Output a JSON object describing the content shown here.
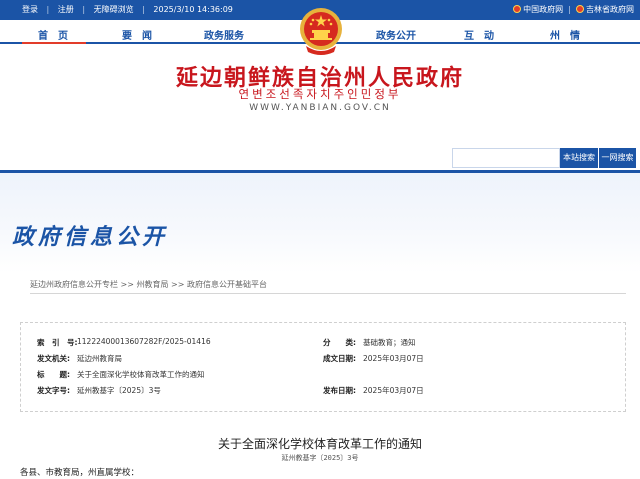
{
  "topbar": {
    "login": "登录",
    "register": "注册",
    "accessibility": "无障碍浏览",
    "datetime": "2025/3/10 14:36:09",
    "link_gov": "中国政府网",
    "link_jilin": "吉林省政府网"
  },
  "nav": {
    "items": [
      "首　页",
      "要　闻",
      "政务服务",
      "政务公开",
      "互　动",
      "州　情"
    ],
    "active_index": 0
  },
  "header": {
    "title_cn": "延边朝鲜族自治州人民政府",
    "title_kr": "연변조선족자치주인민정부",
    "url": "WWW.YANBIAN.GOV.CN"
  },
  "search": {
    "placeholder": "",
    "site_search_label": "本站搜索",
    "all_search_label": "一网搜索"
  },
  "banner": {
    "title": "政府信息公开"
  },
  "breadcrumb": "延边州政府信息公开专栏 >> 州教育局 >> 政府信息公开基础平台",
  "meta": {
    "index_label": "索　引　号:",
    "index_value": "11222400013607282F/2025-01416",
    "category_label": "分　　类:",
    "category_value": "基础教育；通知",
    "issuer_label": "发文机关:",
    "issuer_value": "延边州教育局",
    "created_label": "成文日期:",
    "created_value": "2025年03月07日",
    "title_label": "标　　题:",
    "title_value": "关于全面深化学校体育改革工作的通知",
    "docno_label": "发文字号:",
    "docno_value": "延州教基字〔2025〕3号",
    "published_label": "发布日期:",
    "published_value": "2025年03月07日"
  },
  "document": {
    "title": "关于全面深化学校体育改革工作的通知",
    "number": "延州教基字〔2025〕3号",
    "salutation": "各县、市教育局，州直属学校："
  },
  "colors": {
    "brand_blue": "#1b54a6",
    "title_red": "#c8161d"
  }
}
